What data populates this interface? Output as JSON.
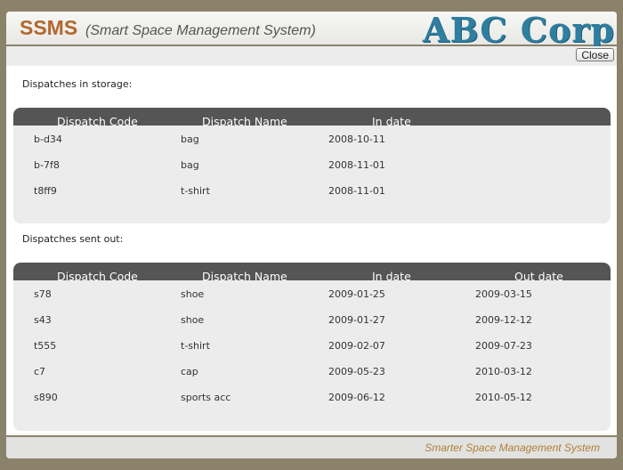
{
  "header": {
    "app_name": "SSMS",
    "app_subtitle": "(Smart Space Management System)",
    "logo_text": "ABC Corp."
  },
  "toolbar": {
    "close_label": "Close"
  },
  "storage": {
    "label": "Dispatches in storage:",
    "columns": [
      "Dispatch Code",
      "Dispatch Name",
      "In date"
    ],
    "rows": [
      [
        "b-d34",
        "bag",
        "2008-10-11"
      ],
      [
        "b-7f8",
        "bag",
        "2008-11-01"
      ],
      [
        "t8ff9",
        "t-shirt",
        "2008-11-01"
      ]
    ]
  },
  "sent": {
    "label": "Dispatches sent out:",
    "columns": [
      "Dispatch Code",
      "Dispatch Name",
      "In date",
      "Out date"
    ],
    "rows": [
      [
        "s78",
        "shoe",
        "2009-01-25",
        "2009-03-15"
      ],
      [
        "s43",
        "shoe",
        "2009-01-27",
        "2009-12-12"
      ],
      [
        "t555",
        "t-shirt",
        "2009-02-07",
        "2009-07-23"
      ],
      [
        "c7",
        "cap",
        "2009-05-23",
        "2010-03-12"
      ],
      [
        "s890",
        "sports acc",
        "2009-06-12",
        "2010-05-12"
      ]
    ]
  },
  "footer": {
    "text": "Smarter Space Management System"
  },
  "colors": {
    "background": "#8b826c",
    "brand_orange": "#b3662f",
    "logo_blue": "#2f7ea0",
    "table_header": "#555555",
    "panel": "#ececec"
  }
}
